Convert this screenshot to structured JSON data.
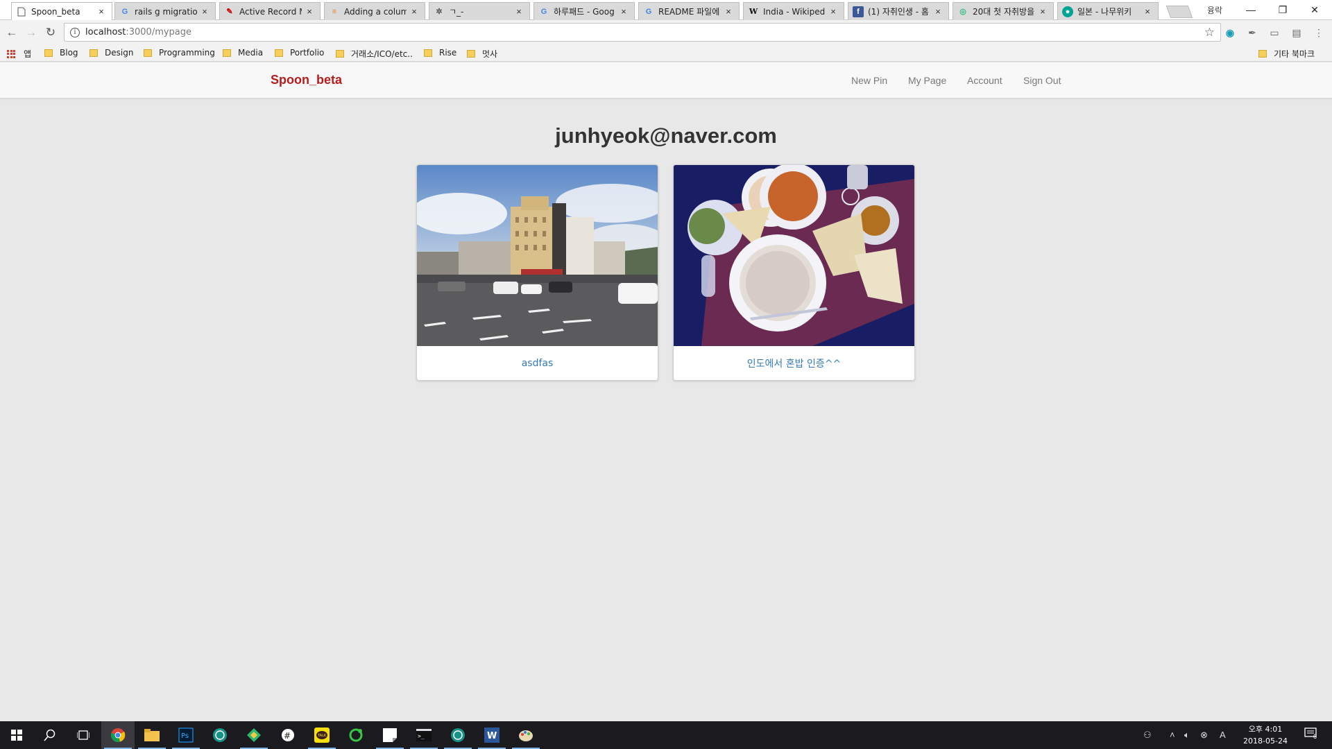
{
  "browser": {
    "tabs": [
      {
        "title": "Spoon_beta",
        "icon": "page-icon",
        "active": true
      },
      {
        "title": "rails g migration",
        "icon": "google-icon"
      },
      {
        "title": "Active Record M",
        "icon": "rails-icon"
      },
      {
        "title": "Adding a column",
        "icon": "stackoverflow-icon"
      },
      {
        "title": "ㄱ_-",
        "icon": "gear-icon"
      },
      {
        "title": "하루패드 - Goog",
        "icon": "google-icon"
      },
      {
        "title": "README 파일에",
        "icon": "google-icon"
      },
      {
        "title": "India - Wikipedia",
        "icon": "wikipedia-icon"
      },
      {
        "title": "(1) 자취인생 - 홈",
        "icon": "facebook-icon"
      },
      {
        "title": "20대 첫 자취방을",
        "icon": "brunch-icon"
      },
      {
        "title": "일본 - 나무위키",
        "icon": "namuwiki-icon"
      }
    ],
    "tab_close": "×",
    "profile_label": "융락",
    "url_host": "localhost",
    "url_path": ":3000/mypage",
    "bookmarks": [
      {
        "label": "앱",
        "type": "apps"
      },
      {
        "label": "Blog",
        "type": "folder"
      },
      {
        "label": "Design",
        "type": "folder"
      },
      {
        "label": "Programming",
        "type": "folder"
      },
      {
        "label": "Media",
        "type": "folder"
      },
      {
        "label": "Portfolio",
        "type": "folder"
      },
      {
        "label": "거래소/ICO/etc..",
        "type": "folder"
      },
      {
        "label": "Rise",
        "type": "folder"
      },
      {
        "label": "멋사",
        "type": "folder"
      }
    ],
    "other_bookmarks": "기타 북마크"
  },
  "site": {
    "brand": "Spoon_beta",
    "brand_color": "#b71c1c",
    "nav": [
      "New Pin",
      "My Page",
      "Account",
      "Sign Out"
    ],
    "page_title": "junhyeok@naver.com",
    "pins": [
      {
        "caption": "asdfas",
        "image": "city-street-photo"
      },
      {
        "caption": "인도에서 혼밥 인증^^",
        "image": "indian-food-photo"
      }
    ],
    "link_color": "#337ab7"
  },
  "taskbar": {
    "apps": [
      "windows-start-icon",
      "search-icon",
      "task-view-icon",
      "chrome-icon",
      "file-explorer-icon",
      "photoshop-icon",
      "gitkraken-icon",
      "sourcetree-icon",
      "slack-icon",
      "kakaotalk-icon",
      "line-icon",
      "sticky-icon",
      "terminal-icon",
      "gitkraken-icon",
      "word-icon",
      "paint-icon"
    ],
    "ime": "A",
    "time": "오후 4:01",
    "date": "2018-05-24",
    "notifications": "6"
  }
}
